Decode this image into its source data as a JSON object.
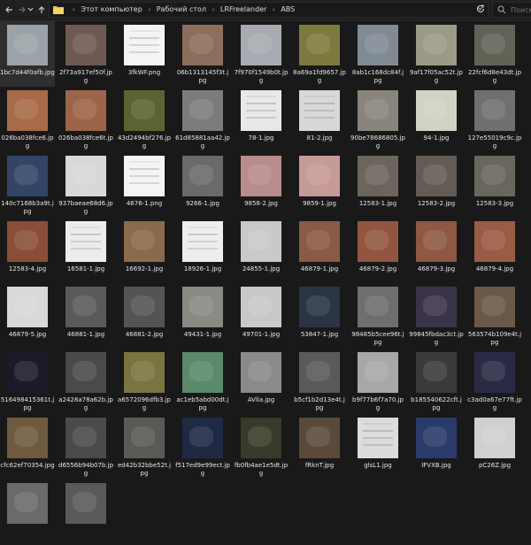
{
  "toolbar": {
    "back_icon": "arrow-left-icon",
    "forward_icon": "arrow-right-icon",
    "recent_icon": "chevron-down-icon",
    "up_icon": "arrow-up-icon",
    "refresh_icon": "refresh-icon",
    "breadcrumbs": [
      "Этот компьютер",
      "Рабочий стол",
      "LRFreelander",
      "ABS"
    ],
    "search_placeholder": "Поиск"
  },
  "files": [
    {
      "name": "1bc7d44f0afb.jpg",
      "color": "#9aa3a8"
    },
    {
      "name": "2f73a917ef50f.jpg",
      "color": "#6e5a52"
    },
    {
      "name": "3fkWF.png",
      "color": "#f4f4f4",
      "doc": true
    },
    {
      "name": "06b1313145f3t.jpg",
      "color": "#8c6e5c"
    },
    {
      "name": "7f970f1549b0t.jpg",
      "color": "#a7aab0"
    },
    {
      "name": "8a69a1fd9657.jpg",
      "color": "#7d7a3e"
    },
    {
      "name": "8ab1c168dc84f.jpg",
      "color": "#808a93"
    },
    {
      "name": "9af17f05ac52t.jpg",
      "color": "#9a9a86"
    },
    {
      "name": "22fcf6d8e43dt.jpg",
      "color": "#5f6457"
    },
    {
      "name": "026ba038fce6.jpg",
      "color": "#a86a48"
    },
    {
      "name": "026ba038fce6t.jpg",
      "color": "#9c6448"
    },
    {
      "name": "43d2494bf276.jpg",
      "color": "#5a6432"
    },
    {
      "name": "61d85881aa42.jpg",
      "color": "#7c7c7c"
    },
    {
      "name": "78-1.jpg",
      "color": "#e8e8e8",
      "doc": true
    },
    {
      "name": "81-2.jpg",
      "color": "#d8d8d8",
      "doc": true
    },
    {
      "name": "90be78686805.jpg",
      "color": "#8a857c"
    },
    {
      "name": "94-1.jpg",
      "color": "#cfd3c4"
    },
    {
      "name": "127e55019c9c.jpg",
      "color": "#707070"
    },
    {
      "name": "140c7168b3a9t.jpg",
      "color": "#334466"
    },
    {
      "name": "937baeae68d6.jpg",
      "color": "#d8d8d8"
    },
    {
      "name": "4676-1.png",
      "color": "#f4f4f4",
      "doc": true
    },
    {
      "name": "9266-1.jpg",
      "color": "#6a6a6a"
    },
    {
      "name": "9858-2.jpg",
      "color": "#b88c8c"
    },
    {
      "name": "9859-1.jpg",
      "color": "#c69a98"
    },
    {
      "name": "12583-1.jpg",
      "color": "#6b655c"
    },
    {
      "name": "12583-2.jpg",
      "color": "#625c54"
    },
    {
      "name": "12583-3.jpg",
      "color": "#6a665e"
    },
    {
      "name": "12583-4.jpg",
      "color": "#8a4e38"
    },
    {
      "name": "16581-1.jpg",
      "color": "#ececec",
      "doc": true
    },
    {
      "name": "16692-1.jpg",
      "color": "#8a6a4a"
    },
    {
      "name": "18926-1.jpg",
      "color": "#eeeeee",
      "doc": true
    },
    {
      "name": "24855-1.jpg",
      "color": "#c9c9c9"
    },
    {
      "name": "46879-1.jpg",
      "color": "#8a5a44"
    },
    {
      "name": "46879-2.jpg",
      "color": "#925640"
    },
    {
      "name": "46879-3.jpg",
      "color": "#8e5842"
    },
    {
      "name": "46879-4.jpg",
      "color": "#9a5c44"
    },
    {
      "name": "46879-5.jpg",
      "color": "#d9d9d9"
    },
    {
      "name": "46881-1.jpg",
      "color": "#5a5a5a"
    },
    {
      "name": "46881-2.jpg",
      "color": "#545454"
    },
    {
      "name": "49431-1.jpg",
      "color": "#8a8a84"
    },
    {
      "name": "49701-1.jpg",
      "color": "#c8c8c8"
    },
    {
      "name": "53847-1.jpg",
      "color": "#2a3444"
    },
    {
      "name": "98485b5cee96t.jpg",
      "color": "#6e6e6e"
    },
    {
      "name": "99845fbdac3ct.jpg",
      "color": "#3a3448"
    },
    {
      "name": "563574b109e4t.jpg",
      "color": "#6a5848"
    },
    {
      "name": "516498415361t.jpg",
      "color": "#1a1a2a"
    },
    {
      "name": "a2428a78a62b.jpg",
      "color": "#4a4a4a"
    },
    {
      "name": "a6572096dfb3.jpg",
      "color": "#7a7440"
    },
    {
      "name": "ac1eb5abd00dt.jpg",
      "color": "#5a8a6a"
    },
    {
      "name": "AVlia.jpg",
      "color": "#8a8a8a"
    },
    {
      "name": "b5cf1b2d13e4t.jpg",
      "color": "#5a5a5a"
    },
    {
      "name": "b9f77b6f7a70.jpg",
      "color": "#a8a8a8"
    },
    {
      "name": "b185540622cft.jpg",
      "color": "#3a3a3a"
    },
    {
      "name": "c3ad0a67e77ft.jpg",
      "color": "#2a2a44"
    },
    {
      "name": "cfc62ef70354.jpg",
      "color": "#6e5a3e"
    },
    {
      "name": "d6556b94b07b.jpg",
      "color": "#4a4a4a"
    },
    {
      "name": "ed42b32bbe52t.jpg",
      "color": "#5a5a54"
    },
    {
      "name": "f517ed9e99ect.jpg",
      "color": "#1e2a44"
    },
    {
      "name": "fb0fb4ae1e5dt.jpg",
      "color": "#3a3a2a"
    },
    {
      "name": "fRknT.jpg",
      "color": "#5a4a3a"
    },
    {
      "name": "glsL1.jpg",
      "color": "#dcdcdc",
      "doc": true
    },
    {
      "name": "IFVXB.jpg",
      "color": "#2a3a6a"
    },
    {
      "name": "pC26Z.jpg",
      "color": "#d0d0d0"
    },
    {
      "name": "",
      "color": "#6a6a6a"
    },
    {
      "name": "",
      "color": "#5a5a5a"
    }
  ]
}
